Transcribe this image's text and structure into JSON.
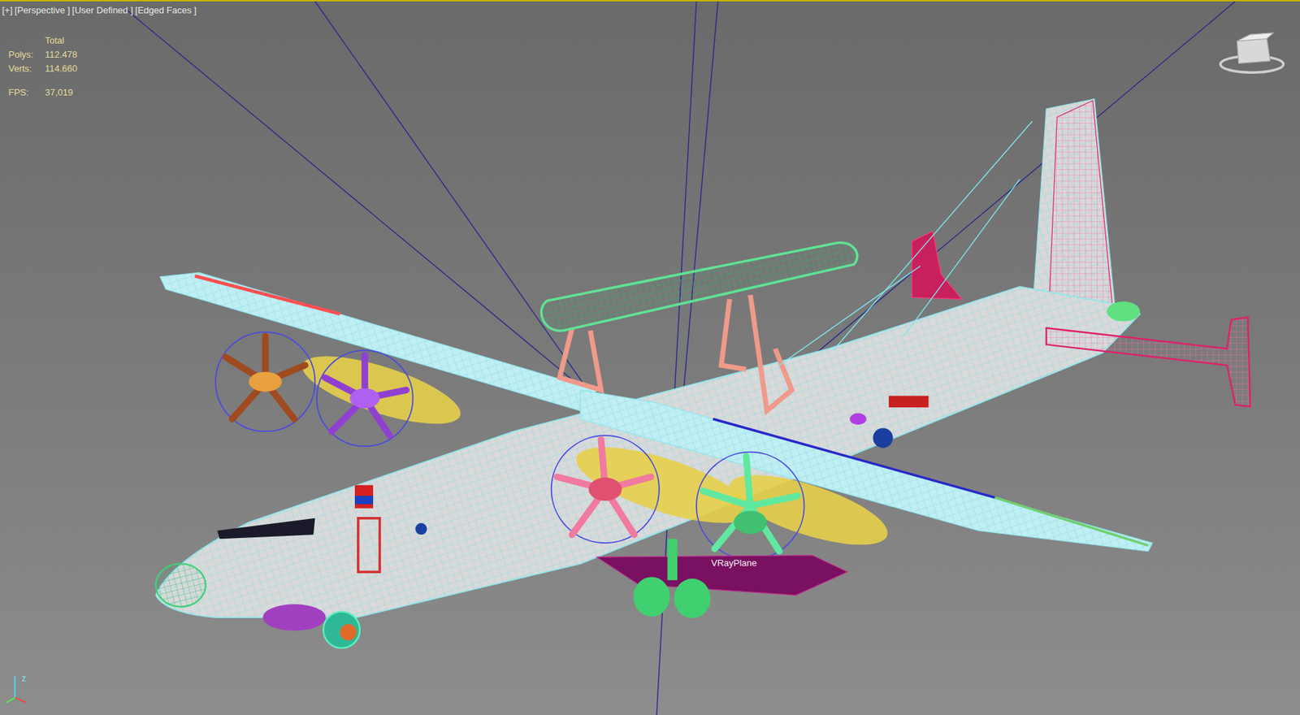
{
  "viewport": {
    "labels": [
      "[+]",
      "[Perspective ]",
      "[User Defined ]",
      "[Edged Faces ]"
    ]
  },
  "stats": {
    "heading": "Total",
    "rows": [
      {
        "label": "Polys:",
        "value": "112.478"
      },
      {
        "label": "Verts:",
        "value": "114.660"
      }
    ],
    "fps": {
      "label": "FPS:",
      "value": "37,019"
    }
  },
  "scene_labels": [
    {
      "text": "VRayPlane"
    }
  ],
  "axis": {
    "z": "z"
  }
}
